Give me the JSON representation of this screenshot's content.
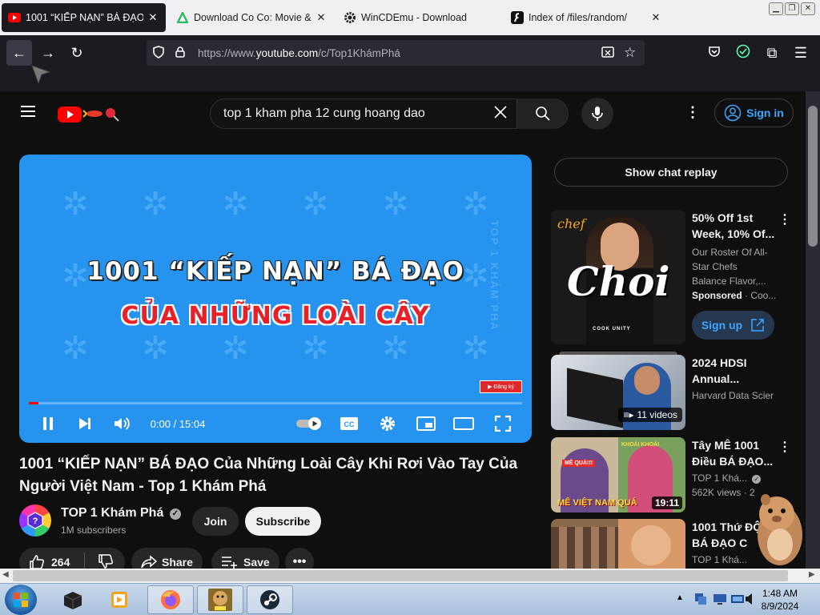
{
  "browser": {
    "tabs": [
      {
        "title": "1001 “KIẾP NẠN” BÁ ĐẠO Củ",
        "icon": "youtube-icon",
        "active": true
      },
      {
        "title": "Download Co Co: Movie & V",
        "icon": "apk-icon",
        "active": false
      },
      {
        "title": "WinCDEmu - Download",
        "icon": "gear-icon",
        "active": false
      },
      {
        "title": "Index of /files/random/",
        "icon": "flash-icon",
        "active": false
      }
    ],
    "url_prefix": "https://www.",
    "url_domain": "youtube.com",
    "url_path": "/c/Top1KhámPhá"
  },
  "youtube": {
    "search_query": "top 1 kham pha 12 cung hoang dao",
    "sign_in_label": "Sign in",
    "video": {
      "overlay_line1": "1001 “KIẾP NẠN” BÁ ĐẠO",
      "overlay_line2": "CỦA NHỮNG LOÀI CÂY",
      "side_watermark": "TOP 1 KHÁM PHÁ",
      "subscribe_badge": "Đăng ký",
      "time": "0:00 / 15:04",
      "progress": 0.02,
      "title": "1001 “KIẾP NẠN” BÁ ĐẠO Của Những Loài Cây Khi Rơi Vào Tay Của Người Việt Nam - Top 1 Khám Phá"
    },
    "channel": {
      "name": "TOP 1 Khám Phá",
      "subscribers": "1M subscribers",
      "join_label": "Join",
      "subscribe_label": "Subscribe"
    },
    "actions": {
      "likes": "264",
      "share_label": "Share",
      "save_label": "Save"
    },
    "chat_replay_label": "Show chat replay",
    "sidebar": [
      {
        "title": "50% Off 1st Week, 10% Of...",
        "line1": "Our Roster Of All-",
        "line2": "Star Chefs",
        "line3": "Balance Flavor,...",
        "sponsor": "Sponsored",
        "sponsor_rest": " · Coo...",
        "cta": "Sign up",
        "thumb_text": "Choi",
        "thumb_text2": "chef",
        "thumb_text3": "COOK UNITY"
      },
      {
        "title": "2024 HDSI Annual...",
        "channel": "Harvard Data Scier",
        "badge": "11 videos"
      },
      {
        "title": "Tây MÊ 1001 Điều BÁ ĐẠO...",
        "channel": "TOP 1 Khá...",
        "views": "562K views · 2",
        "duration": "19:11",
        "thumb_text": "MÊ VIỆT NAM QUÁ",
        "thumb_tag": "KHOÁI KHOÁI",
        "thumb_tag2": "MÊ QUÁ!!!"
      },
      {
        "title": "1001 Thứ ĐỘ LẠ BÁ ĐẠO C",
        "channel": "TOP 1 Khá..."
      }
    ]
  },
  "taskbar": {
    "time": "1:48 AM",
    "date": "8/9/2024"
  }
}
